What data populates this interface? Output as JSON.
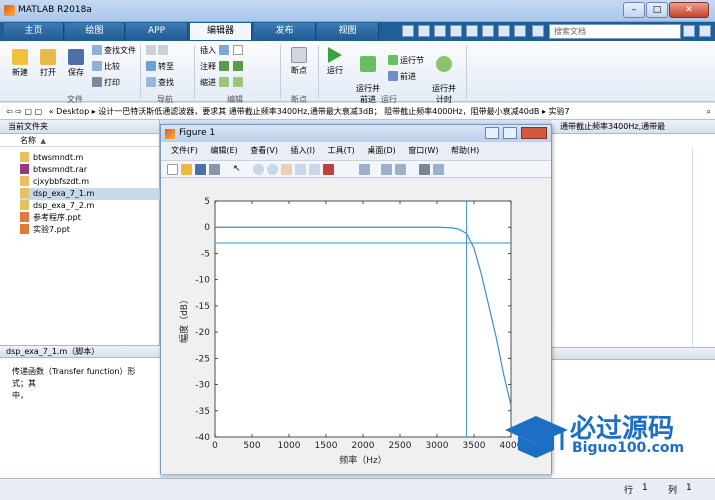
{
  "window": {
    "title": "MATLAB R2018a"
  },
  "tabs": [
    {
      "label": "主页"
    },
    {
      "label": "绘图"
    },
    {
      "label": "APP"
    },
    {
      "label": "编辑器"
    },
    {
      "label": "发布"
    },
    {
      "label": "视图"
    }
  ],
  "search": {
    "placeholder": "搜索文档"
  },
  "ribbon": {
    "new": "新建",
    "open": "打开",
    "save": "保存",
    "find_files": "查找文件",
    "compare": "比较",
    "print": "打印",
    "goto": "转至",
    "find": "查找",
    "insert": "插入",
    "comment": "注释",
    "indent": "缩进",
    "breakpoints": "断点",
    "run": "运行",
    "run_advance": "运行并\n前进",
    "run_section": "运行节",
    "advance": "前进",
    "run_time": "运行并\n计时",
    "groups": {
      "file": "文件",
      "nav": "导航",
      "edit": "编辑",
      "bp": "断点",
      "run": "运行"
    }
  },
  "address": {
    "path": "« Desktop ▸ 设计一巴特沃斯低通滤波器，要求其 通带截止频率3400Hz,通带最大衰减3dB； 阻带截止频率4000Hz，阻带最小衰减40dB ▸ 实验7",
    "right_text": "通带截止频率3400Hz,通带最"
  },
  "current_folder": {
    "title": "当前文件夹",
    "col_name": "名称",
    "sort_indicator": "▲",
    "files": [
      {
        "name": "btwsmndt.m",
        "type": "m"
      },
      {
        "name": "btwsmndt.rar",
        "type": "rar"
      },
      {
        "name": "cjxybbfszdt.m",
        "type": "m"
      },
      {
        "name": "dsp_exa_7_1.m",
        "type": "m",
        "selected": true
      },
      {
        "name": "dsp_exa_7_2.m",
        "type": "m"
      },
      {
        "name": "参考程序.ppt",
        "type": "ppt"
      },
      {
        "name": "实验7.ppt",
        "type": "ppt"
      }
    ]
  },
  "details": {
    "title": "dsp_exa_7_1.m（脚本）",
    "text": "传递函数（Transfer function）形式；其\n中，"
  },
  "status": {
    "row_label": "行",
    "row": "1",
    "col_label": "列",
    "col": "1"
  },
  "figure": {
    "title": "Figure 1",
    "menu": [
      "文件(F)",
      "编辑(E)",
      "查看(V)",
      "插入(I)",
      "工具(T)",
      "桌面(D)",
      "窗口(W)",
      "帮助(H)"
    ]
  },
  "chart_data": {
    "type": "line",
    "title": "",
    "xlabel": "频率（Hz）",
    "ylabel": "幅度（dB）",
    "xlim": [
      0,
      4000
    ],
    "ylim": [
      -40,
      5
    ],
    "xticks": [
      0,
      500,
      1000,
      1500,
      2000,
      2500,
      3000,
      3500,
      4000
    ],
    "yticks": [
      5,
      0,
      -5,
      -10,
      -15,
      -20,
      -25,
      -30,
      -35,
      -40
    ],
    "grid": false,
    "series": [
      {
        "values_x": [
          0,
          500,
          1000,
          1500,
          2000,
          2500,
          2800,
          3000,
          3200,
          3300,
          3400,
          3500,
          3600,
          3700,
          3800,
          3900,
          4000
        ],
        "values_y": [
          0,
          0,
          0,
          0,
          0,
          0,
          0,
          0,
          -0.1,
          -0.4,
          -1.2,
          -4,
          -9,
          -15,
          -21,
          -28,
          -34
        ],
        "color": "#3d8fd0"
      }
    ],
    "reference_lines": [
      {
        "orientation": "horizontal",
        "value": -3
      },
      {
        "orientation": "vertical",
        "value": 3400
      }
    ]
  },
  "watermark": {
    "text": "必过源码",
    "sub": "Biguo100.com"
  }
}
